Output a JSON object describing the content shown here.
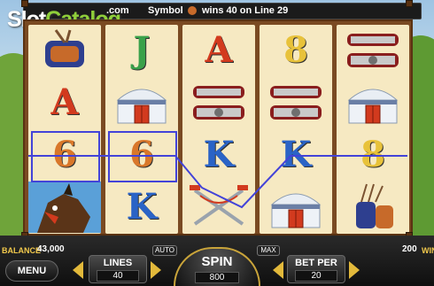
{
  "logo": {
    "part1": "Slot",
    "part2": "Catalog",
    "suffix": ".com"
  },
  "top_message": {
    "symbol_label": "Symbol",
    "win_text": "wins 40 on Line 29"
  },
  "reels": [
    [
      "pouch-icon",
      "A",
      "6",
      "horse-icon"
    ],
    [
      "J",
      "yurt-icon",
      "6",
      "K"
    ],
    [
      "A",
      "belt-icon",
      "K",
      "swords-icon"
    ],
    [
      "8",
      "belt-icon",
      "K",
      "yurt-icon"
    ],
    [
      "belt-icon",
      "yurt-icon",
      "8",
      "arrows-quiver-icon"
    ]
  ],
  "colors": {
    "A": "#d23a1e",
    "J": "#3aa14a",
    "K": "#2a63c6",
    "6": "#d9772a",
    "8": "#e8c23a",
    "win_line": "#4343d8",
    "accent": "#e2b93b"
  },
  "winning_cells": [
    [
      0,
      2
    ],
    [
      1,
      2
    ]
  ],
  "balance": {
    "label": "BALANCE",
    "value": "43,000"
  },
  "win": {
    "value": "200",
    "label": "WIN"
  },
  "buttons": {
    "menu": "MENU",
    "auto": "AUTO",
    "max": "MAX"
  },
  "lines": {
    "label": "LINES",
    "value": "40"
  },
  "spin": {
    "label": "SPIN",
    "value": "800"
  },
  "bet_per": {
    "label": "BET PER",
    "value": "20"
  }
}
